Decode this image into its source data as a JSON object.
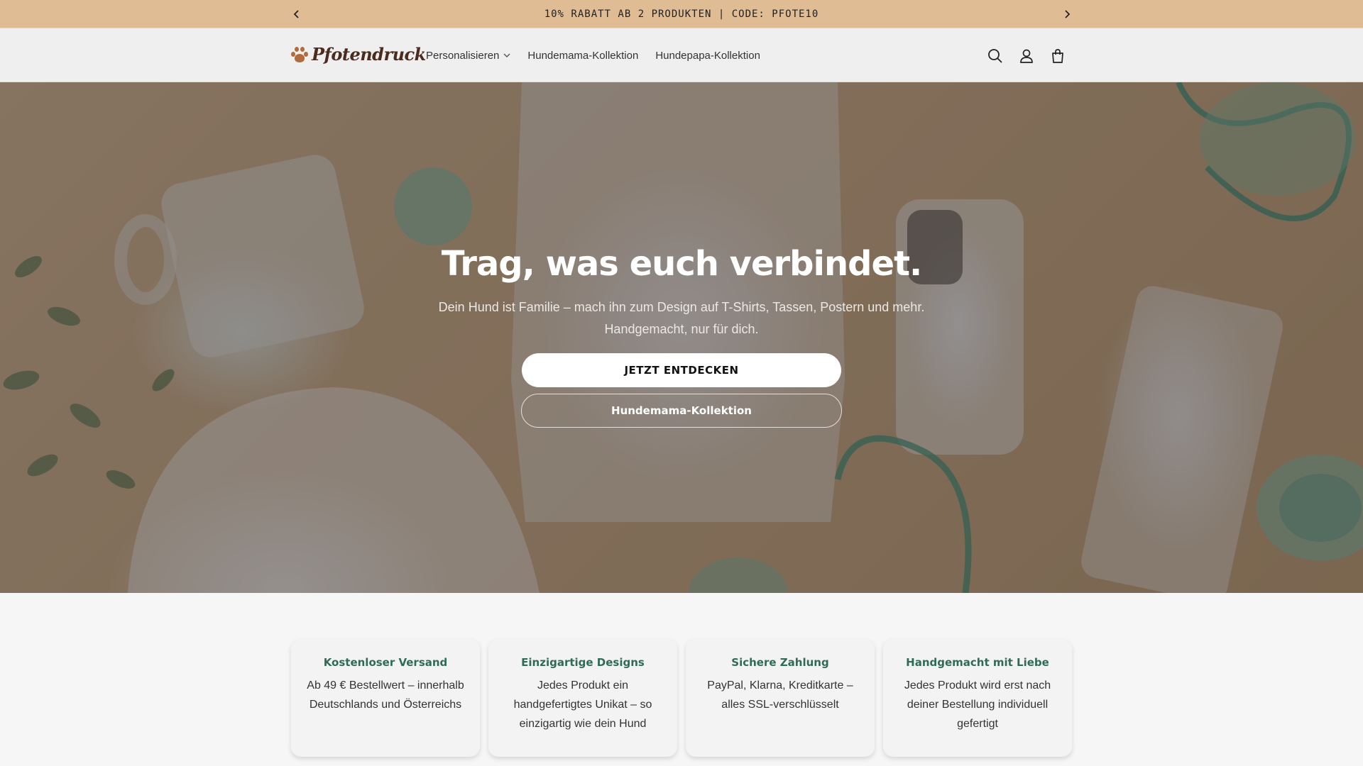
{
  "announcement": {
    "text": "10% RABATT AB 2 PRODUKTEN | CODE: PFOTE10",
    "prev_icon": "chevron-left-icon",
    "next_icon": "chevron-right-icon"
  },
  "header": {
    "logo_text": "Pfotendruck",
    "nav": [
      {
        "label": "Personalisieren",
        "has_dropdown": true
      },
      {
        "label": "Hundemama-Kollektion"
      },
      {
        "label": "Hundepapa-Kollektion"
      }
    ],
    "icons": [
      "search-icon",
      "account-icon",
      "cart-icon"
    ]
  },
  "hero": {
    "title": "Trag, was euch verbindet.",
    "subtitle_line1": "Dein Hund ist Familie – mach ihn zum Design auf T-Shirts, Tassen, Postern und mehr.",
    "subtitle_line2": "Handgemacht, nur für dich.",
    "primary_button": "JETZT ENTDECKEN",
    "secondary_button": "Hundemama-Kollektion"
  },
  "features": [
    {
      "title": "Kostenloser Versand",
      "text": "Ab 49 € Bestellwert – innerhalb Deutschlands und Österreichs"
    },
    {
      "title": "Einzigartige Designs",
      "text": "Jedes Produkt ein handgefertigtes Unikat – so einzigartig wie dein Hund"
    },
    {
      "title": "Sichere Zahlung",
      "text": "PayPal, Klarna, Kreditkarte – alles SSL-verschlüsselt"
    },
    {
      "title": "Handgemacht mit Liebe",
      "text": "Jedes Produkt wird erst nach deiner Bestellung individuell gefertigt"
    }
  ],
  "colors": {
    "announcement_bg": "#e0bc94",
    "feature_title": "#2f6b57",
    "logo_paw": "#b36a3c"
  }
}
